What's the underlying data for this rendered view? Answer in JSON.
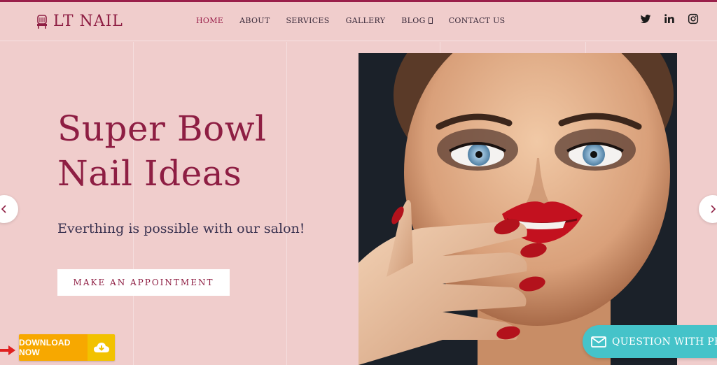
{
  "brand": {
    "name": "LT NAIL",
    "color": "#8e1e43"
  },
  "nav": {
    "items": [
      {
        "label": "HOME",
        "active": true
      },
      {
        "label": "ABOUT",
        "active": false
      },
      {
        "label": "SERVICES",
        "active": false
      },
      {
        "label": "GALLERY",
        "active": false
      },
      {
        "label": "BLOG",
        "active": false
      },
      {
        "label": "CONTACT US",
        "active": false
      }
    ]
  },
  "social": [
    "twitter-icon",
    "linkedin-icon",
    "instagram-icon"
  ],
  "hero": {
    "title_line1": "Super Bowl",
    "title_line2": "Nail Ideas",
    "subtitle": "Everthing is possible with our salon!",
    "cta_label": "MAKE AN APPOINTMENT"
  },
  "download": {
    "label": "DOWNLOAD NOW",
    "icon": "cloud-download-icon"
  },
  "question": {
    "label": "QUESTION WITH PR",
    "icon": "envelope-icon"
  },
  "colors": {
    "background": "#f0cdcc",
    "accent": "#9a1f4a",
    "download": "#f7a800",
    "question": "#45c3c9"
  }
}
